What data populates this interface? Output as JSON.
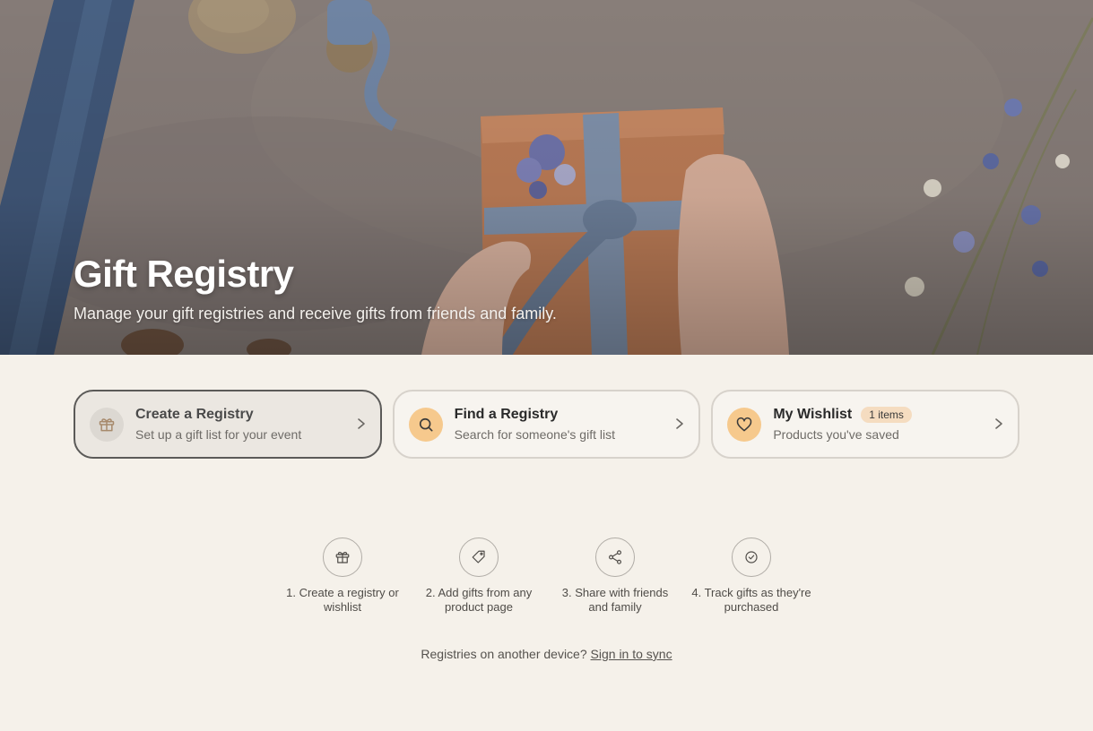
{
  "hero": {
    "title": "Gift Registry",
    "subtitle": "Manage your gift registries and receive gifts from friends and family."
  },
  "cards": [
    {
      "title": "Create a Registry",
      "subtitle": "Set up a gift list for your event",
      "icon": "gift-icon"
    },
    {
      "title": "Find a Registry",
      "subtitle": "Search for someone's gift list",
      "icon": "search-icon"
    },
    {
      "title": "My Wishlist",
      "badge": "1 items",
      "subtitle": "Products you've saved",
      "icon": "heart-icon"
    }
  ],
  "steps": [
    {
      "label": "1. Create a registry or wishlist",
      "icon": "gift-icon"
    },
    {
      "label": "2. Add gifts from any product page",
      "icon": "tag-icon"
    },
    {
      "label": "3. Share with friends and family",
      "icon": "share-icon"
    },
    {
      "label": "4. Track gifts as they're purchased",
      "icon": "check-circle-icon"
    }
  ],
  "sync": {
    "text": "Registries on another device?",
    "link": "Sign in to sync"
  },
  "colors": {
    "background": "#f5f1ea",
    "accent_orange": "#f6c98d",
    "badge": "#f5dcc0",
    "active_border": "#5b5a58"
  }
}
